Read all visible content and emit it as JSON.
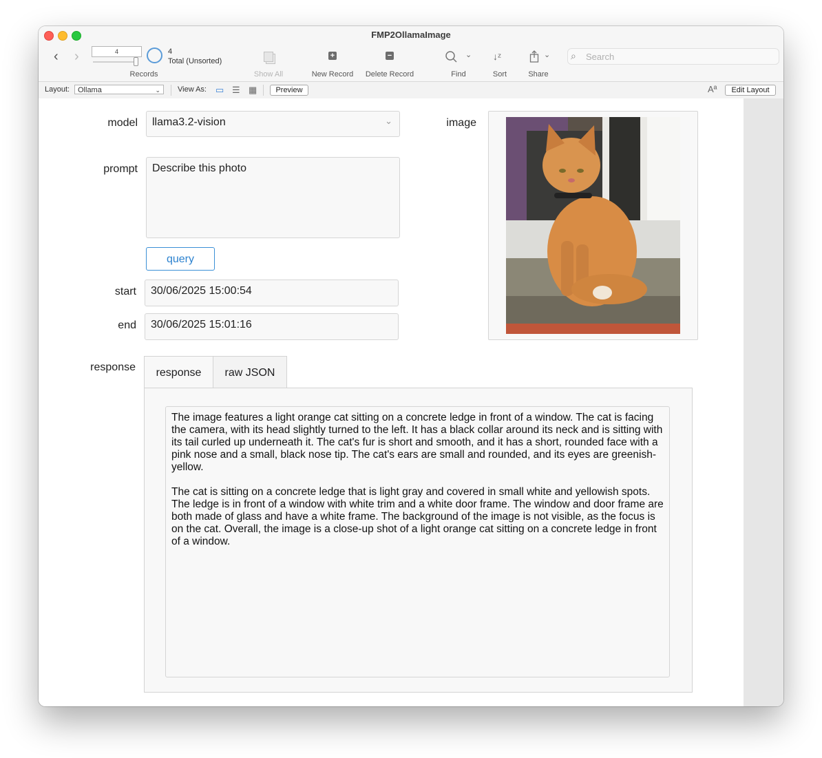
{
  "window": {
    "title": "FMP2OllamaImage"
  },
  "toolbar": {
    "record_field_value": "4",
    "record_count": "4",
    "record_total": "Total (Unsorted)",
    "records_label": "Records",
    "show_all_label": "Show All",
    "new_record_label": "New Record",
    "delete_record_label": "Delete Record",
    "find_label": "Find",
    "sort_label": "Sort",
    "share_label": "Share",
    "search_placeholder": "Search"
  },
  "layoutbar": {
    "layout_label": "Layout:",
    "layout_value": "Ollama",
    "view_as_label": "View As:",
    "preview_label": "Preview",
    "edit_layout_label": "Edit Layout",
    "text_format_icon": "Aª"
  },
  "form": {
    "model_label": "model",
    "model_value": "llama3.2-vision",
    "prompt_label": "prompt",
    "prompt_value": "Describe this photo",
    "query_label": "query",
    "start_label": "start",
    "start_value": "30/06/2025 15:00:54",
    "end_label": "end",
    "end_value": "30/06/2025 15:01:16",
    "image_label": "image",
    "response_label": "response"
  },
  "tabs": [
    {
      "label": "response",
      "active": true
    },
    {
      "label": "raw JSON",
      "active": false
    }
  ],
  "response": {
    "paragraph1": "The image features a light orange cat sitting on a concrete ledge in front of a window. The cat is facing the camera, with its head slightly turned to the left. It has a black collar around its neck and is sitting with its tail curled up underneath it. The cat's fur is short and smooth, and it has a short, rounded face with a pink nose and a small, black nose tip. The cat's ears are small and rounded, and its eyes are greenish-yellow.",
    "paragraph2": "The cat is sitting on a concrete ledge that is light gray and covered in small white and yellowish spots. The ledge is in front of a window with white trim and a white door frame. The window and door frame are both made of glass and have a white frame. The background of the image is not visible, as the focus is on the cat. Overall, the image is a close-up shot of a light orange cat sitting on a concrete ledge in front of a window."
  },
  "colors": {
    "accent": "#2c82cf",
    "close": "#fe5f57",
    "minimize": "#febc2e",
    "maximize": "#28c840"
  }
}
